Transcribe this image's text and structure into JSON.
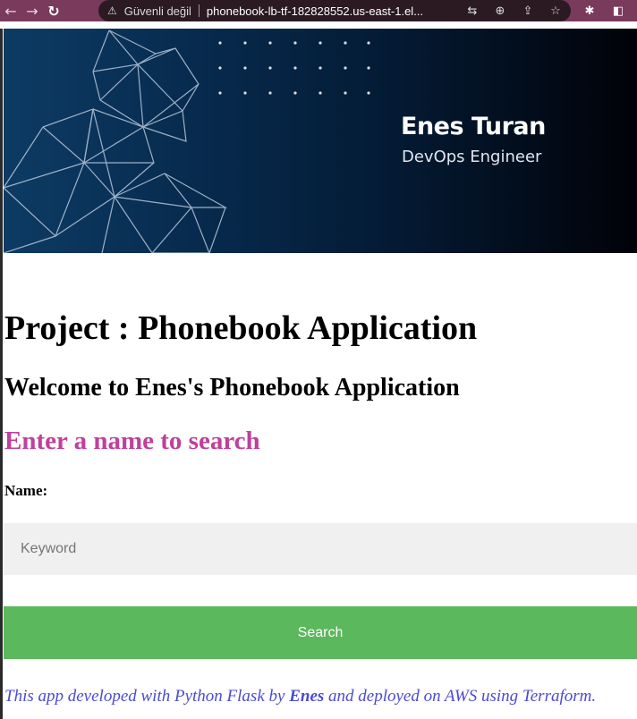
{
  "browser": {
    "security_text": "Güvenli değil",
    "url": "phonebook-lb-tf-182828552.us-east-1.el...",
    "icons": [
      "back-icon",
      "forward-icon",
      "reload-icon",
      "warning-icon",
      "translate-icon",
      "zoom-icon",
      "share-icon",
      "star-icon",
      "extensions-icon",
      "sidepanel-icon"
    ]
  },
  "banner": {
    "name": "Enes Turan",
    "role": "DevOps Engineer",
    "colors": {
      "background_start": "#0d3b64",
      "background_end": "#010208"
    }
  },
  "page": {
    "title": "Project : Phonebook Application",
    "welcome": "Welcome to Enes's Phonebook Application",
    "search_heading": "Enter a name to search",
    "name_label": "Name:",
    "keyword_placeholder": "Keyword",
    "keyword_value": "",
    "search_button": "Search",
    "footer_before": "This app developed with Python Flask by ",
    "footer_author": "Enes",
    "footer_after": " and deployed on AWS using Terraform."
  },
  "colors": {
    "heading_accent": "#c0409a",
    "button": "#5cb85c",
    "footer_text": "#4a4ad8",
    "toolbar": "#7a3a5c"
  }
}
